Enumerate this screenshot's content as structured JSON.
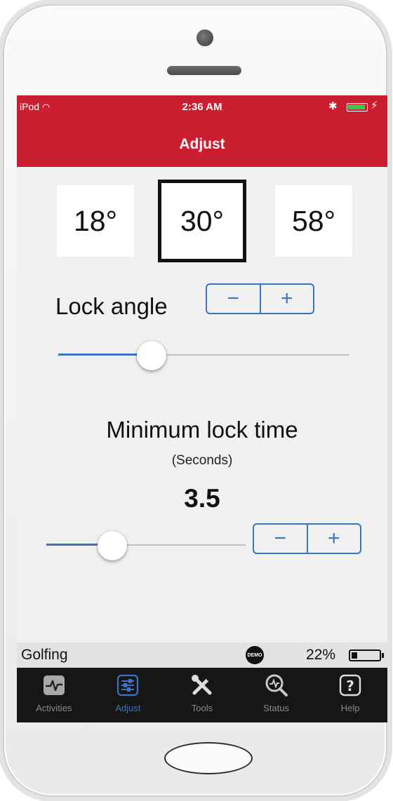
{
  "status_bar": {
    "carrier": "iPod",
    "time": "2:36 AM"
  },
  "nav": {
    "title": "Adjust"
  },
  "angles": {
    "options": [
      "18°",
      "30°",
      "58°"
    ],
    "selected": "30°"
  },
  "lock_angle": {
    "label": "Lock angle",
    "minus": "−",
    "plus": "+",
    "slider_level": 0.32
  },
  "min_lock_time": {
    "title": "Minimum lock time",
    "unit": "(Seconds)",
    "value": "3.5",
    "slider_level": 0.33,
    "minus": "−",
    "plus": "+"
  },
  "info_bar": {
    "mode": "Golfing",
    "demo_badge": "DEMO",
    "battery_percent": "22%"
  },
  "tabs": [
    {
      "label": "Activities",
      "icon": "activity-icon",
      "active": false
    },
    {
      "label": "Adjust",
      "icon": "adjust-icon",
      "active": true
    },
    {
      "label": "Tools",
      "icon": "tools-icon",
      "active": false
    },
    {
      "label": "Status",
      "icon": "status-icon",
      "active": false
    },
    {
      "label": "Help",
      "icon": "help-icon",
      "active": false
    }
  ],
  "colors": {
    "header_red": "#cc1e31",
    "accent_blue": "#3b74c4",
    "tab_bar_bg": "#161616"
  }
}
